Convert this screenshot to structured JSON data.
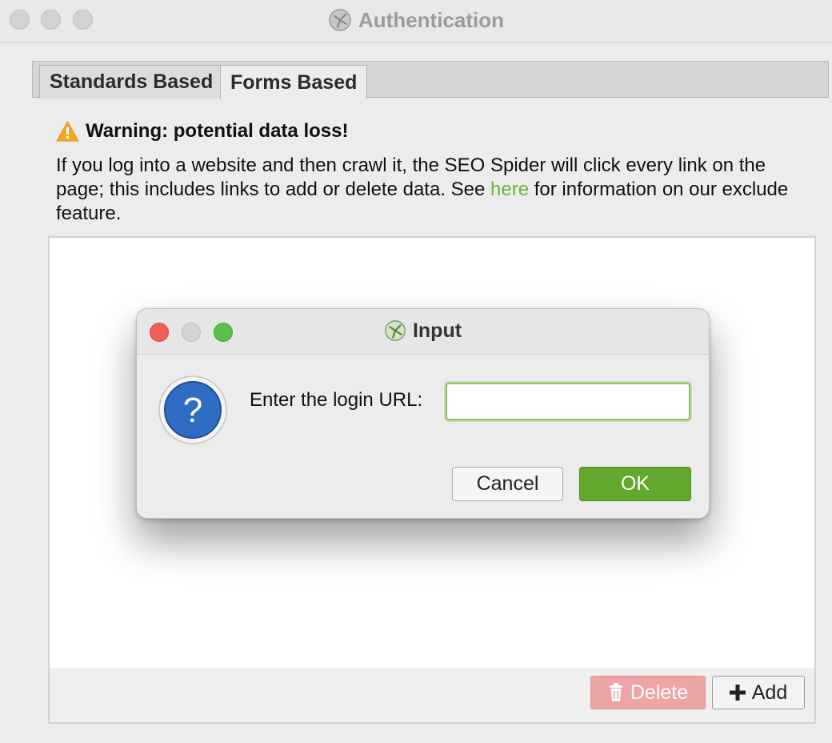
{
  "window": {
    "title": "Authentication",
    "app_icon": "seo-spider-logo-icon",
    "traffic_lights": [
      "close-disabled",
      "minimize-disabled",
      "zoom-disabled"
    ]
  },
  "tabs": [
    {
      "label": "Standards Based",
      "active": false
    },
    {
      "label": "Forms Based",
      "active": true
    }
  ],
  "warning": {
    "icon": "warning-triangle-icon",
    "title": "Warning: potential data loss!",
    "body_before": "If you log into a website and then crawl it, the SEO Spider will click every link on the page; this includes links to add or delete data. See ",
    "link_text": "here",
    "body_after": " for information on our exclude feature."
  },
  "panel": {
    "delete_label": "Delete",
    "add_label": "Add"
  },
  "dialog": {
    "title": "Input",
    "icon": "question-mark-icon",
    "field_label": "Enter the login URL:",
    "field_value": "",
    "cancel_label": "Cancel",
    "ok_label": "OK"
  },
  "colors": {
    "accent_green": "#62a82e",
    "link_green": "#6ab43a",
    "warning_orange": "#f5a623",
    "delete_red": "#eca4a4"
  }
}
